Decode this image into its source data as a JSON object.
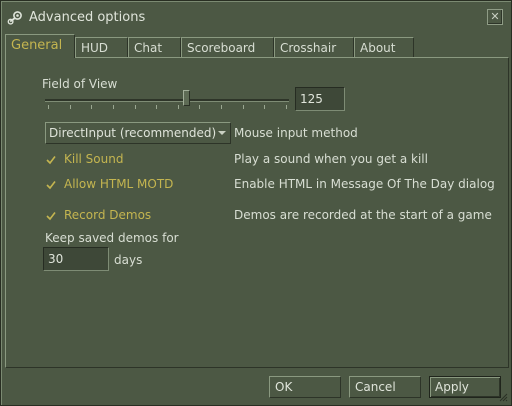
{
  "window": {
    "title": "Advanced options"
  },
  "tabs": [
    {
      "label": "General",
      "active": true
    },
    {
      "label": "HUD"
    },
    {
      "label": "Chat"
    },
    {
      "label": "Scoreboard"
    },
    {
      "label": "Crosshair"
    },
    {
      "label": "About"
    }
  ],
  "general": {
    "fov_label": "Field of View",
    "fov_value": "125",
    "fov_slider_fraction": 0.58,
    "mouse_method_value": "DirectInput (recommended)",
    "mouse_method_label": "Mouse input method",
    "kill_sound": {
      "label": "Kill Sound",
      "checked": true,
      "description": "Play a sound when you get a kill"
    },
    "html_motd": {
      "label": "Allow HTML MOTD",
      "checked": true,
      "description": "Enable HTML in Message Of The Day dialog"
    },
    "record_demos": {
      "label": "Record Demos",
      "checked": true,
      "description": "Demos are recorded at the start of a game"
    },
    "keep_demos_label": "Keep saved demos for",
    "keep_demos_value": "30",
    "keep_demos_unit": "days"
  },
  "buttons": {
    "ok": "OK",
    "cancel": "Cancel",
    "apply": "Apply"
  },
  "colors": {
    "background": "#4c5844",
    "accent_text": "#c4b550",
    "text": "#d8ded3"
  }
}
